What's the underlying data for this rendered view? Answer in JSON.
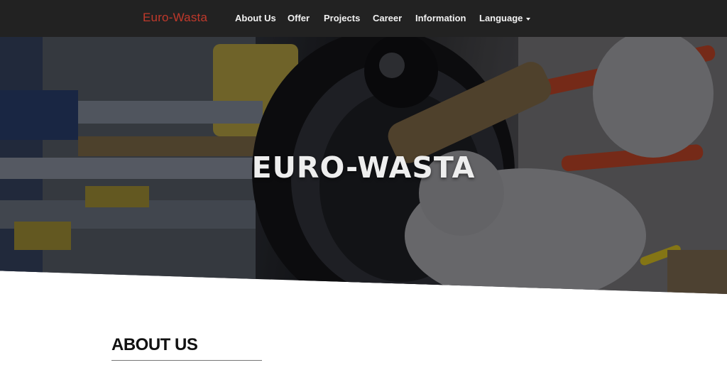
{
  "brand": {
    "name": "Euro-Wasta",
    "color": "#c0392b"
  },
  "nav": {
    "items": [
      {
        "label": "About Us"
      },
      {
        "label": "Offer"
      },
      {
        "label": "Projects"
      },
      {
        "label": "Career"
      },
      {
        "label": "Information"
      },
      {
        "label": "Language",
        "has_dropdown": true,
        "icon": "caret-down-icon"
      }
    ]
  },
  "hero": {
    "title": "EURO-WASTA",
    "background_image": "industrial pipe wrench on black valve handwheel, gloved hands"
  },
  "about": {
    "heading": "ABOUT US"
  },
  "colors": {
    "navbar_bg": "#222222",
    "nav_text": "#f2f2f2",
    "heading": "#111111"
  }
}
